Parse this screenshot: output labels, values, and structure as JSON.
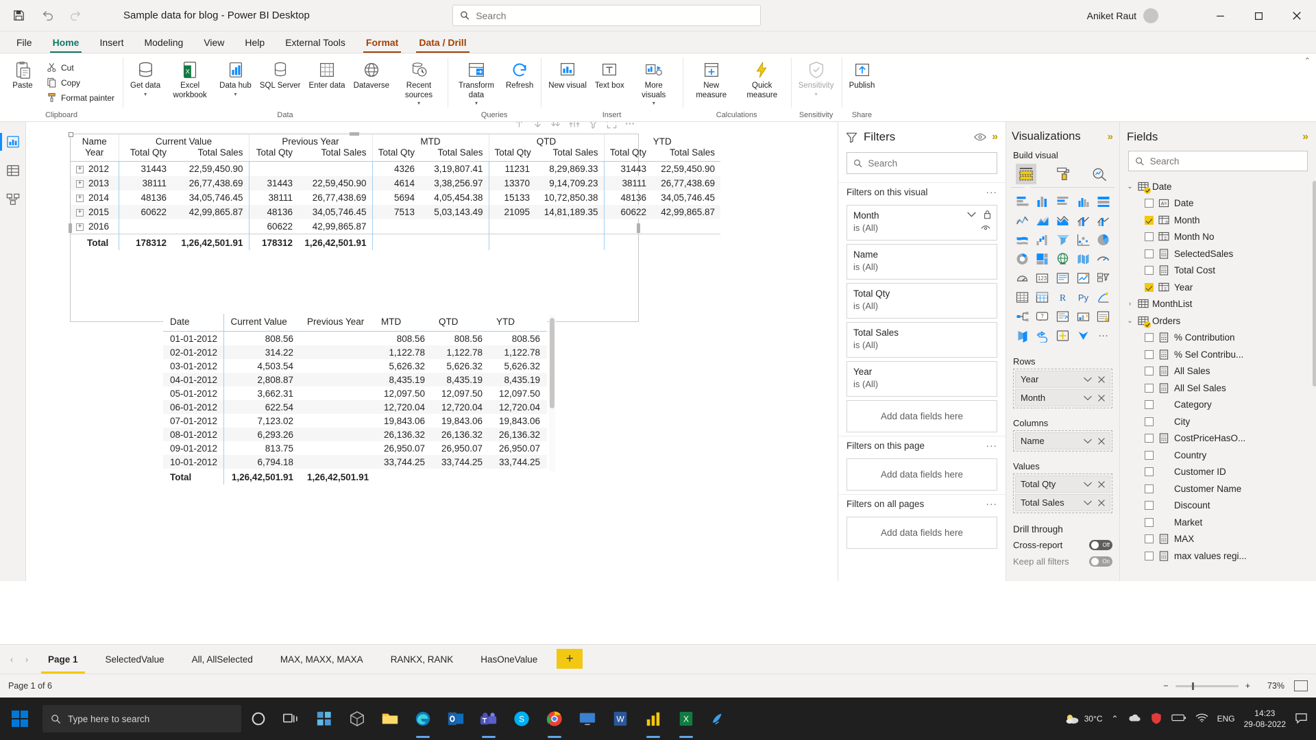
{
  "titlebar": {
    "app_title": "Sample data for blog - Power BI Desktop",
    "search_placeholder": "Search",
    "user_name": "Aniket Raut",
    "save_icon": "save-icon",
    "undo_icon": "undo-icon",
    "redo_icon": "redo-icon",
    "minimize": "–",
    "maximize": "□",
    "close": "✕"
  },
  "ribbon_tabs": [
    {
      "label": "File",
      "active": false,
      "contextual": false
    },
    {
      "label": "Home",
      "active": true,
      "contextual": false
    },
    {
      "label": "Insert",
      "active": false,
      "contextual": false
    },
    {
      "label": "Modeling",
      "active": false,
      "contextual": false
    },
    {
      "label": "View",
      "active": false,
      "contextual": false
    },
    {
      "label": "Help",
      "active": false,
      "contextual": false
    },
    {
      "label": "External Tools",
      "active": false,
      "contextual": false
    },
    {
      "label": "Format",
      "active": true,
      "contextual": true
    },
    {
      "label": "Data / Drill",
      "active": true,
      "contextual": true
    }
  ],
  "ribbon": {
    "clipboard": {
      "group_label": "Clipboard",
      "paste": "Paste",
      "cut": "Cut",
      "copy": "Copy",
      "format_painter": "Format painter"
    },
    "data": {
      "group_label": "Data",
      "items": [
        {
          "label": "Get data",
          "caret": true,
          "icon": "get-data-icon"
        },
        {
          "label": "Excel workbook",
          "caret": false,
          "icon": "excel-icon"
        },
        {
          "label": "Data hub",
          "caret": true,
          "icon": "data-hub-icon"
        },
        {
          "label": "SQL Server",
          "caret": false,
          "icon": "sql-server-icon"
        },
        {
          "label": "Enter data",
          "caret": false,
          "icon": "enter-data-icon"
        },
        {
          "label": "Dataverse",
          "caret": false,
          "icon": "dataverse-icon"
        },
        {
          "label": "Recent sources",
          "caret": true,
          "icon": "recent-sources-icon"
        }
      ]
    },
    "queries": {
      "group_label": "Queries",
      "items": [
        {
          "label": "Transform data",
          "caret": true,
          "icon": "transform-data-icon"
        },
        {
          "label": "Refresh",
          "caret": false,
          "icon": "refresh-icon"
        }
      ]
    },
    "insert": {
      "group_label": "Insert",
      "items": [
        {
          "label": "New visual",
          "caret": false,
          "icon": "new-visual-icon"
        },
        {
          "label": "Text box",
          "caret": false,
          "icon": "text-box-icon"
        },
        {
          "label": "More visuals",
          "caret": true,
          "icon": "more-visuals-icon"
        }
      ]
    },
    "calculations": {
      "group_label": "Calculations",
      "items": [
        {
          "label": "New measure",
          "caret": false,
          "icon": "new-measure-icon"
        },
        {
          "label": "Quick measure",
          "caret": false,
          "icon": "quick-measure-icon"
        }
      ]
    },
    "sensitivity": {
      "group_label": "Sensitivity",
      "items": [
        {
          "label": "Sensitivity",
          "caret": true,
          "icon": "sensitivity-icon"
        }
      ]
    },
    "share": {
      "group_label": "Share",
      "items": [
        {
          "label": "Publish",
          "caret": false,
          "icon": "publish-icon"
        }
      ]
    }
  },
  "left_rail": [
    {
      "name": "report-view",
      "icon": "report-icon",
      "active": true
    },
    {
      "name": "data-view",
      "icon": "table-icon",
      "active": false
    },
    {
      "name": "model-view",
      "icon": "model-icon",
      "active": false
    }
  ],
  "visual_toolbar_icons": [
    "drill-up-icon",
    "drill-down-icon",
    "expand-all-icon",
    "expand-hierarchy-icon",
    "filter-icon",
    "focus-mode-icon",
    "more-options-icon"
  ],
  "chart_data": [
    {
      "type": "table",
      "name": "matrix-visual",
      "title": "",
      "corner_labels": [
        "Name",
        "Year"
      ],
      "column_groups": [
        {
          "label": "Current Value",
          "sub": [
            "Total Qty",
            "Total Sales"
          ]
        },
        {
          "label": "Previous Year",
          "sub": [
            "Total Qty",
            "Total Sales"
          ]
        },
        {
          "label": "MTD",
          "sub": [
            "Total Qty",
            "Total Sales"
          ]
        },
        {
          "label": "QTD",
          "sub": [
            "Total Qty",
            "Total Sales"
          ]
        },
        {
          "label": "YTD",
          "sub": [
            "Total Qty",
            "Total Sales"
          ]
        }
      ],
      "rows": [
        {
          "year": "2012",
          "cells": [
            "31443",
            "22,59,450.90",
            "",
            "",
            "4326",
            "3,19,807.41",
            "11231",
            "8,29,869.33",
            "31443",
            "22,59,450.90"
          ]
        },
        {
          "year": "2013",
          "cells": [
            "38111",
            "26,77,438.69",
            "31443",
            "22,59,450.90",
            "4614",
            "3,38,256.97",
            "13370",
            "9,14,709.23",
            "38111",
            "26,77,438.69"
          ]
        },
        {
          "year": "2014",
          "cells": [
            "48136",
            "34,05,746.45",
            "38111",
            "26,77,438.69",
            "5694",
            "4,05,454.38",
            "15133",
            "10,72,850.38",
            "48136",
            "34,05,746.45"
          ]
        },
        {
          "year": "2015",
          "cells": [
            "60622",
            "42,99,865.87",
            "48136",
            "34,05,746.45",
            "7513",
            "5,03,143.49",
            "21095",
            "14,81,189.35",
            "60622",
            "42,99,865.87"
          ]
        },
        {
          "year": "2016",
          "cells": [
            "",
            "",
            "60622",
            "42,99,865.87",
            "",
            "",
            "",
            "",
            "",
            ""
          ]
        }
      ],
      "total_row": {
        "label": "Total",
        "cells": [
          "178312",
          "1,26,42,501.91",
          "178312",
          "1,26,42,501.91",
          "",
          "",
          "",
          "",
          "",
          ""
        ]
      }
    },
    {
      "type": "table",
      "name": "detail-table-visual",
      "headers": [
        "Date",
        "Current Value",
        "Previous Year",
        "MTD",
        "QTD",
        "YTD"
      ],
      "rows": [
        [
          "01-01-2012",
          "808.56",
          "",
          "808.56",
          "808.56",
          "808.56"
        ],
        [
          "02-01-2012",
          "314.22",
          "",
          "1,122.78",
          "1,122.78",
          "1,122.78"
        ],
        [
          "03-01-2012",
          "4,503.54",
          "",
          "5,626.32",
          "5,626.32",
          "5,626.32"
        ],
        [
          "04-01-2012",
          "2,808.87",
          "",
          "8,435.19",
          "8,435.19",
          "8,435.19"
        ],
        [
          "05-01-2012",
          "3,662.31",
          "",
          "12,097.50",
          "12,097.50",
          "12,097.50"
        ],
        [
          "06-01-2012",
          "622.54",
          "",
          "12,720.04",
          "12,720.04",
          "12,720.04"
        ],
        [
          "07-01-2012",
          "7,123.02",
          "",
          "19,843.06",
          "19,843.06",
          "19,843.06"
        ],
        [
          "08-01-2012",
          "6,293.26",
          "",
          "26,136.32",
          "26,136.32",
          "26,136.32"
        ],
        [
          "09-01-2012",
          "813.75",
          "",
          "26,950.07",
          "26,950.07",
          "26,950.07"
        ],
        [
          "10-01-2012",
          "6,794.18",
          "",
          "33,744.25",
          "33,744.25",
          "33,744.25"
        ]
      ],
      "total_row": [
        "Total",
        "1,26,42,501.91",
        "1,26,42,501.91",
        "",
        "",
        ""
      ]
    }
  ],
  "filters": {
    "title": "Filters",
    "search_placeholder": "Search",
    "eye_icon": "eye-icon",
    "collapse_icon": "chevron-double-right-icon",
    "sections": [
      {
        "label": "Filters on this visual",
        "cards": [
          {
            "name": "Month",
            "value": "is (All)",
            "locked": true
          },
          {
            "name": "Name",
            "value": "is (All)",
            "locked": false
          },
          {
            "name": "Total Qty",
            "value": "is (All)",
            "locked": false
          },
          {
            "name": "Total Sales",
            "value": "is (All)",
            "locked": false
          },
          {
            "name": "Year",
            "value": "is (All)",
            "locked": false
          }
        ],
        "dropzone": "Add data fields here"
      },
      {
        "label": "Filters on this page",
        "cards": [],
        "dropzone": "Add data fields here"
      },
      {
        "label": "Filters on all pages",
        "cards": [],
        "dropzone": "Add data fields here"
      }
    ]
  },
  "visualizations": {
    "title": "Visualizations",
    "collapse_icon": "chevron-double-right-icon",
    "build_label": "Build visual",
    "tabs": [
      {
        "name": "build-visual-tab",
        "icon": "build-fields-icon",
        "selected": true
      },
      {
        "name": "format-visual-tab",
        "icon": "format-paint-roller-icon",
        "selected": false
      },
      {
        "name": "analytics-tab",
        "icon": "analytics-magnifier-icon",
        "selected": false
      }
    ],
    "gallery_icons": [
      "stacked-bar-chart-icon",
      "stacked-column-chart-icon",
      "clustered-bar-chart-icon",
      "clustered-column-chart-icon",
      "100-stacked-bar-icon",
      "line-chart-icon",
      "area-chart-icon",
      "stacked-area-chart-icon",
      "line-stacked-column-icon",
      "line-clustered-column-icon",
      "ribbon-chart-icon",
      "waterfall-chart-icon",
      "funnel-icon",
      "scatter-chart-icon",
      "pie-chart-icon",
      "donut-chart-icon",
      "treemap-icon",
      "map-icon",
      "filled-map-icon",
      "shape-map-icon",
      "azure-map-icon",
      "gauge-icon",
      "card-icon",
      "multi-row-card-icon",
      "kpi-icon",
      "slicer-icon",
      "table-icon",
      "matrix-icon",
      "r-script-icon",
      "python-script-icon",
      "key-influencers-icon",
      "decomposition-tree-icon",
      "qa-icon",
      "smart-narrative-icon",
      "metrics-icon",
      "paginated-report-icon",
      "power-apps-icon",
      "power-automate-icon",
      "get-more-visuals-icon"
    ],
    "wells": [
      {
        "label": "Rows",
        "items": [
          "Year",
          "Month"
        ],
        "empty_text": ""
      },
      {
        "label": "Columns",
        "items": [
          "Name"
        ],
        "empty_text": ""
      },
      {
        "label": "Values",
        "items": [
          "Total Qty",
          "Total Sales"
        ],
        "empty_text": ""
      },
      {
        "label": "Drill through",
        "items": [],
        "empty_text": ""
      }
    ],
    "drill_through": {
      "label": "Drill through",
      "cross_report": {
        "label": "Cross-report",
        "state": "Off"
      },
      "keep_all_filters": {
        "label": "Keep all filters",
        "state": "On"
      }
    }
  },
  "fields": {
    "title": "Fields",
    "collapse_icon": "chevron-double-right-icon",
    "search_placeholder": "Search",
    "tree": [
      {
        "type": "table",
        "label": "Date",
        "expanded": true,
        "checked": true,
        "icon": "table-calc-icon"
      },
      {
        "type": "field",
        "label": "Date",
        "checked": false,
        "icon": "text-field-icon"
      },
      {
        "type": "field",
        "label": "Month",
        "checked": true,
        "icon": "calculated-column-icon"
      },
      {
        "type": "field",
        "label": "Month No",
        "checked": false,
        "icon": "sum-column-icon"
      },
      {
        "type": "field",
        "label": "SelectedSales",
        "checked": false,
        "icon": "measure-icon"
      },
      {
        "type": "field",
        "label": "Total Cost",
        "checked": false,
        "icon": "measure-icon"
      },
      {
        "type": "field",
        "label": "Year",
        "checked": true,
        "icon": "sum-column-icon"
      },
      {
        "type": "table",
        "label": "MonthList",
        "expanded": false,
        "checked": false,
        "icon": "table-calc-icon"
      },
      {
        "type": "table",
        "label": "Orders",
        "expanded": true,
        "checked": true,
        "icon": "table-icon"
      },
      {
        "type": "field",
        "label": "% Contribution",
        "checked": false,
        "icon": "measure-icon"
      },
      {
        "type": "field",
        "label": "% Sel Contribu...",
        "checked": false,
        "icon": "measure-icon"
      },
      {
        "type": "field",
        "label": "All Sales",
        "checked": false,
        "icon": "measure-icon"
      },
      {
        "type": "field",
        "label": "All Sel Sales",
        "checked": false,
        "icon": "measure-icon"
      },
      {
        "type": "field",
        "label": "Category",
        "checked": false,
        "icon": "none"
      },
      {
        "type": "field",
        "label": "City",
        "checked": false,
        "icon": "none"
      },
      {
        "type": "field",
        "label": "CostPriceHasO...",
        "checked": false,
        "icon": "measure-icon"
      },
      {
        "type": "field",
        "label": "Country",
        "checked": false,
        "icon": "none"
      },
      {
        "type": "field",
        "label": "Customer ID",
        "checked": false,
        "icon": "none"
      },
      {
        "type": "field",
        "label": "Customer Name",
        "checked": false,
        "icon": "none"
      },
      {
        "type": "field",
        "label": "Discount",
        "checked": false,
        "icon": "none"
      },
      {
        "type": "field",
        "label": "Market",
        "checked": false,
        "icon": "none"
      },
      {
        "type": "field",
        "label": "MAX",
        "checked": false,
        "icon": "measure-icon"
      },
      {
        "type": "field",
        "label": "max values regi...",
        "checked": false,
        "icon": "measure-icon"
      }
    ]
  },
  "page_tabs": {
    "prev_icon": "chevron-left-icon",
    "next_icon": "chevron-right-icon",
    "tabs": [
      {
        "label": "Page 1",
        "active": true
      },
      {
        "label": "SelectedValue",
        "active": false
      },
      {
        "label": "All, AllSelected",
        "active": false
      },
      {
        "label": "MAX, MAXX, MAXA",
        "active": false
      },
      {
        "label": "RANKX, RANK",
        "active": false
      },
      {
        "label": "HasOneValue",
        "active": false
      }
    ],
    "add_label": "+"
  },
  "statusbar": {
    "page_label": "Page 1 of 6",
    "zoom_out": "−",
    "zoom_in": "+",
    "zoom_level": "73%",
    "fit_icon": "fit-to-page-icon"
  },
  "taskbar": {
    "search_placeholder": "Type here to search",
    "icons": [
      "cortana-icon",
      "task-view-icon",
      "widgets-icon",
      "3d-viewer-icon",
      "file-explorer-icon",
      "edge-icon",
      "outlook-icon",
      "teams-icon",
      "skype-icon",
      "chrome-icon",
      "display-icon",
      "word-icon",
      "power-bi-icon",
      "excel-icon",
      "app-icon"
    ],
    "weather": "30°C",
    "tray_up": "chevron-up-icon",
    "lang": "ENG",
    "time": "14:23",
    "date": "29-08-2022",
    "notifications": "notification-icon"
  },
  "colors": {
    "accent_yellow": "#f2c811",
    "accent_teal": "#117865",
    "contextual_orange": "#a33f00",
    "selection_blue": "#118dff",
    "pane_bg": "#f3f2f1"
  }
}
